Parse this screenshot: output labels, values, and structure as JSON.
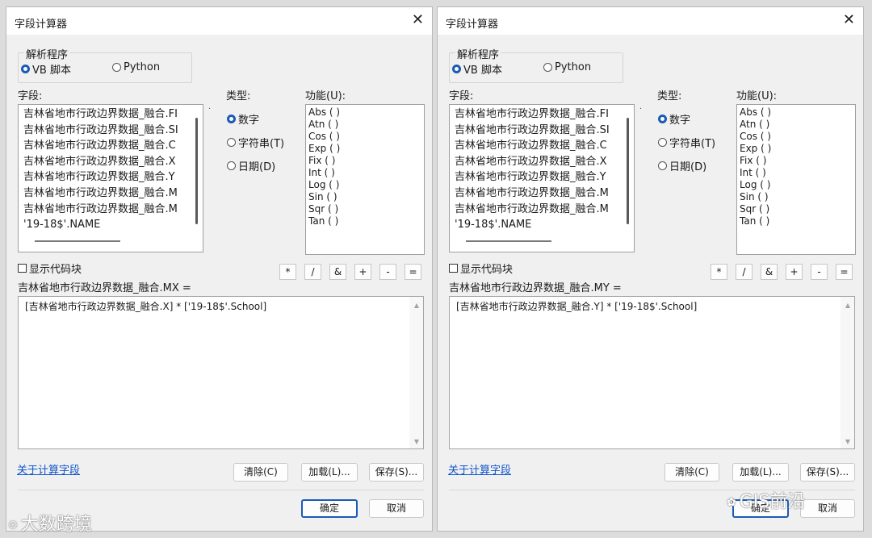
{
  "dialogs": [
    {
      "title": "字段计算器",
      "parser_group_label": "解析程序",
      "parser_vb": "VB 脚本",
      "parser_python": "Python",
      "fields_label": "字段:",
      "fields": [
        "吉林省地市行政边界数据_融合.FI",
        "吉林省地市行政边界数据_融合.SI",
        "吉林省地市行政边界数据_融合.C",
        "吉林省地市行政边界数据_融合.X",
        "吉林省地市行政边界数据_融合.Y",
        "吉林省地市行政边界数据_融合.M",
        "吉林省地市行政边界数据_融合.M",
        "'19-18$'.NAME"
      ],
      "type_label": "类型:",
      "type_number": "数字",
      "type_string": "字符串(T)",
      "type_date": "日期(D)",
      "functions_label": "功能(U):",
      "functions": [
        "Abs ( )",
        "Atn ( )",
        "Cos ( )",
        "Exp ( )",
        "Fix ( )",
        "Int ( )",
        "Log ( )",
        "Sin ( )",
        "Sqr ( )",
        "Tan ( )"
      ],
      "show_codeblock": "显示代码块",
      "operators": [
        "*",
        "/",
        "&",
        "+",
        "-",
        "="
      ],
      "expression_label": "吉林省地市行政边界数据_融合.MX =",
      "expression": "[吉林省地市行政边界数据_融合.X] * ['19-18$'.School]",
      "about_link": "关于计算字段",
      "clear": "清除(C)",
      "load": "加载(L)...",
      "save": "保存(S)...",
      "ok": "确定",
      "cancel": "取消"
    },
    {
      "title": "字段计算器",
      "parser_group_label": "解析程序",
      "parser_vb": "VB 脚本",
      "parser_python": "Python",
      "fields_label": "字段:",
      "fields": [
        "吉林省地市行政边界数据_融合.FI",
        "吉林省地市行政边界数据_融合.SI",
        "吉林省地市行政边界数据_融合.C",
        "吉林省地市行政边界数据_融合.X",
        "吉林省地市行政边界数据_融合.Y",
        "吉林省地市行政边界数据_融合.M",
        "吉林省地市行政边界数据_融合.M",
        "'19-18$'.NAME"
      ],
      "type_label": "类型:",
      "type_number": "数字",
      "type_string": "字符串(T)",
      "type_date": "日期(D)",
      "functions_label": "功能(U):",
      "functions": [
        "Abs ( )",
        "Atn ( )",
        "Cos ( )",
        "Exp ( )",
        "Fix ( )",
        "Int ( )",
        "Log ( )",
        "Sin ( )",
        "Sqr ( )",
        "Tan ( )"
      ],
      "show_codeblock": "显示代码块",
      "operators": [
        "*",
        "/",
        "&",
        "+",
        "-",
        "="
      ],
      "expression_label": "吉林省地市行政边界数据_融合.MY =",
      "expression": "[吉林省地市行政边界数据_融合.Y] * ['19-18$'.School]",
      "about_link": "关于计算字段",
      "clear": "清除(C)",
      "load": "加载(L)...",
      "save": "保存(S)...",
      "ok": "确定",
      "cancel": "取消"
    }
  ],
  "watermarks": {
    "left": "大数跨境",
    "right": "GIS前沿"
  }
}
